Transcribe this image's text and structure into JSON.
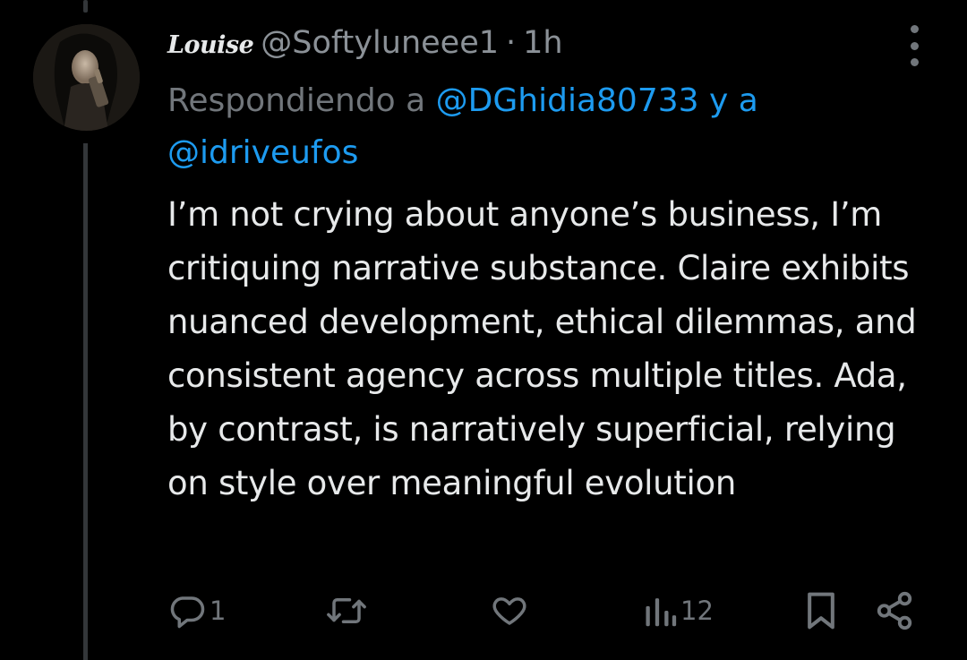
{
  "user": {
    "display_name": "Louise",
    "handle": "@Softyluneee1",
    "separator": "·",
    "time": "1h"
  },
  "reply": {
    "prefix": "Respondiendo a",
    "mention1": "@DGhidia80733",
    "conjunction": "y a",
    "mention2": "@idriveufos"
  },
  "tweet": {
    "text": "I’m not crying about anyone’s business, I’m critiquing narrative substance. Claire exhibits nuanced development, ethical dilemmas, and consistent agency across multiple titles. Ada, by contrast, is narratively superficial, relying on style over meaningful evolution"
  },
  "actions": {
    "reply_count": "1",
    "views_count": "12"
  },
  "icons": [
    "avatar",
    "more-options-icon",
    "reply-icon",
    "retweet-icon",
    "like-icon",
    "views-icon",
    "bookmark-icon",
    "share-icon"
  ],
  "colors": {
    "background": "#000000",
    "text": "#e7e9ea",
    "secondary": "#71767b",
    "accent": "#1d9bf0",
    "thread_line": "#333639"
  }
}
